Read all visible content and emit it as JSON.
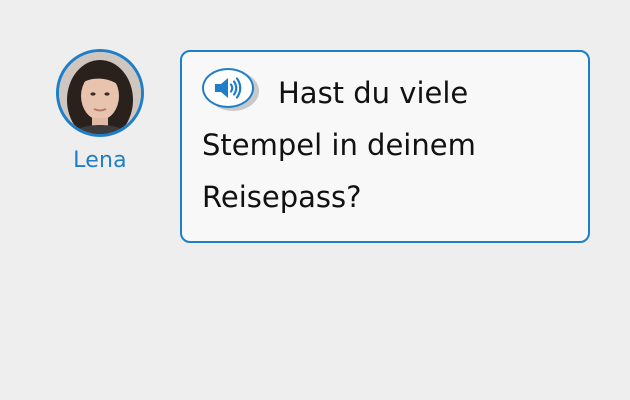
{
  "speaker": {
    "name": "Lena"
  },
  "dialogue": {
    "line_1": "Hast du viele",
    "line_2": "Stempel in deinem",
    "line_3": "Reisepass?"
  },
  "icons": {
    "audio": "speaker-volume-icon",
    "avatar": "portrait-photo"
  },
  "colors": {
    "accent": "#1f7ec8",
    "background": "#eeeeee",
    "bubble": "#f8f8f8",
    "text": "#111111"
  }
}
